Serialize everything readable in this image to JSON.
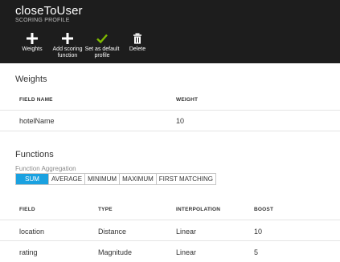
{
  "header": {
    "title": "closeToUser",
    "subtitle": "SCORING PROFILE"
  },
  "commands": {
    "weights": "Weights",
    "add_function": "Add scoring\nfunction",
    "set_default": "Set as default\nprofile",
    "delete": "Delete"
  },
  "colors": {
    "header_bg": "#1d1d1d",
    "accent": "#1aa1e0",
    "check_green": "#7fba00"
  },
  "weights": {
    "title": "Weights",
    "col_field": "FIELD NAME",
    "col_weight": "WEIGHT",
    "rows": [
      {
        "field": "hotelName",
        "weight": "10"
      }
    ]
  },
  "functions": {
    "title": "Functions",
    "aggregation_label": "Function Aggregation",
    "aggregation_options": [
      "SUM",
      "AVERAGE",
      "MINIMUM",
      "MAXIMUM",
      "FIRST MATCHING"
    ],
    "aggregation_selected": "SUM",
    "col_field": "FIELD",
    "col_type": "TYPE",
    "col_interpolation": "INTERPOLATION",
    "col_boost": "BOOST",
    "rows": [
      {
        "field": "location",
        "type": "Distance",
        "interpolation": "Linear",
        "boost": "10"
      },
      {
        "field": "rating",
        "type": "Magnitude",
        "interpolation": "Linear",
        "boost": "5"
      }
    ]
  }
}
